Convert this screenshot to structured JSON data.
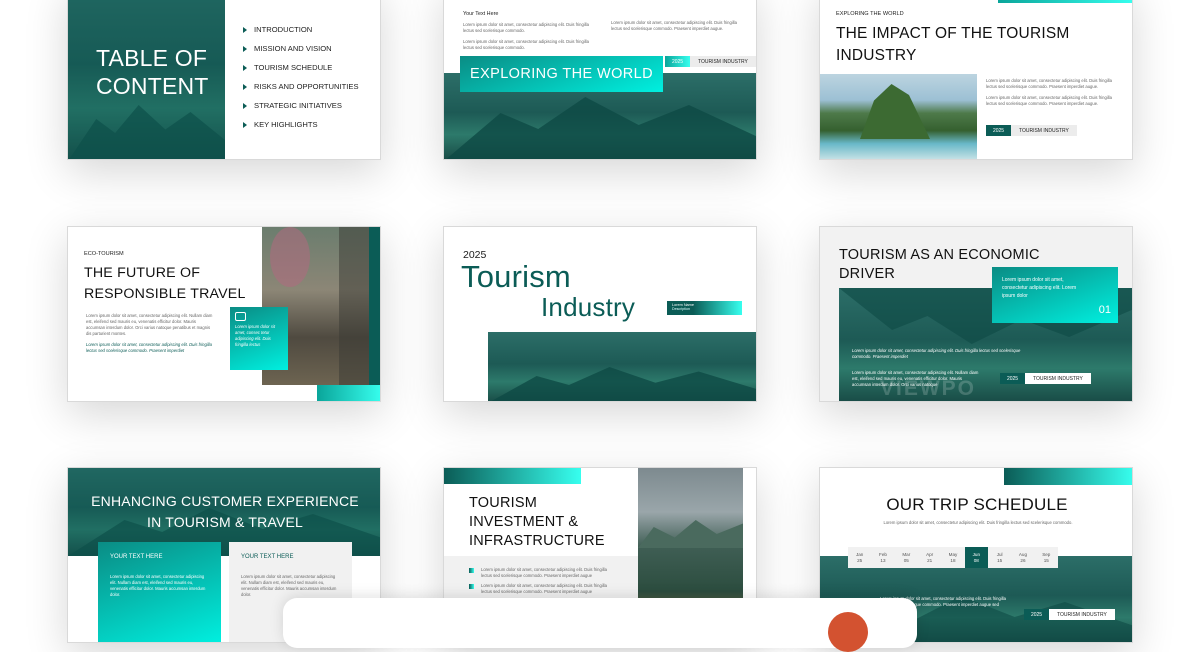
{
  "s1": {
    "title_l1": "TABLE OF",
    "title_l2": "CONTENT",
    "items": [
      "INTRODUCTION",
      "MISSION AND VISION",
      "TOURISM SCHEDULE",
      "RISKS AND OPPORTUNITIES",
      "STRATEGIC INITIATIVES",
      "KEY HIGHLIGHTS"
    ]
  },
  "s2": {
    "your_text": "Your Text Here",
    "lorem_a": "Lorem ipsum dolor sit amet, consectetur adipiscing elit. Duis fringilla lectus sed scelerisque commodo.",
    "lorem_b": "Lorem ipsum dolor sit amet, consectetur adipiscing elit. Duis fringilla lectus sed scelerisque commodo.",
    "lorem_c": "Lorem ipsum dolor sit amet, consectetur adipiscing elit. Duis fringilla lectus sed scelerisque commodo. Praesent imperdiet augue.",
    "banner": "EXPLORING THE WORLD",
    "year": "2025",
    "tag": "TOURISM INDUSTRY"
  },
  "s3": {
    "kicker": "EXPLORING THE WORLD",
    "title_l1": "THE IMPACT OF THE TOURISM",
    "title_l2": "INDUSTRY",
    "lorem_a": "Lorem ipsum dolor sit amet, consectetur adipiscing elit. Duis fringilla lectus sed scelerisque commodo. Praesent imperdiet augue.",
    "lorem_b": "Lorem ipsum dolor sit amet, consectetur adipiscing elit. Duis fringilla lectus sed scelerisque commodo. Praesent imperdiet augue.",
    "year": "2025",
    "tag": "TOURISM INDUSTRY"
  },
  "s4": {
    "kicker": "ECO-TOURISM",
    "title_l1": "THE FUTURE OF",
    "title_l2": "RESPONSIBLE TRAVEL",
    "lorem_a": "Lorem ipsum dolor sit amet, consectetur adipiscing elit. Nullam diam est, eleifend sed mauris eu, venenatis efficitur dolor. Mauris accumsan interdum dolor. Orci varius natoque penatibus et magnis dis parturient montes.",
    "lorem_b": "Lorem ipsum dolor sit amet, consectetur adipiscing elit. Duis fringilla lectus sed scelerisque commodo. Praesent imperdiet",
    "box_text": "Lorem ipsum dolor sit amet, consec tetur adipiscing elit. Duis fringilla lectus"
  },
  "s5": {
    "year": "2025",
    "title_l1": "Tourism",
    "title_l2": "Industry",
    "tag_l1": "Lorem Name",
    "tag_l2": "Description"
  },
  "s6": {
    "title_l1": "TOURISM AS AN ECONOMIC",
    "title_l2": "DRIVER",
    "box_text": "Lorem ipsum dolor sit amet, consectetur adipiscing elit. Lorem ipsum dolor",
    "box_num": "01",
    "lorem_a": "Lorem ipsum dolor sit amet, consectetur adipiscing elit. Duis fringilla lectus sed scelerisque commodo. Praesent imperdiet",
    "lorem_b": "Lorem ipsum dolor sit amet, consectetur adipiscing elit. Nullam diam est, eleifend sed mauris eu, venenatis efficitur dolor. Mauris accumsan interdum dolor. Orci varius natoque",
    "watermark": "VIEWPO",
    "year": "2025",
    "tag": "TOURISM INDUSTRY"
  },
  "s7": {
    "title_l1": "ENHANCING CUSTOMER EXPERIENCE",
    "title_l2": "IN TOURISM & TRAVEL",
    "card1_title": "YOUR TEXT HERE",
    "card1_text": "Lorem ipsum dolor sit amet, consectetur adipiscing elit. Nullam diam est, eleifend sed mauris eu, venenatis efficitur dolor. Mauris accumsan interdum dolor.",
    "card2_title": "YOUR TEXT HERE",
    "card2_text": "Lorem ipsum dolor sit amet, consectetur adipiscing elit. Nullam diam est, eleifend sed mauris eu, venenatis efficitur dolor. Mauris accumsan interdum dolor."
  },
  "s8": {
    "title_l1": "TOURISM",
    "title_l2": "INVESTMENT &",
    "title_l3": "INFRASTRUCTURE",
    "lorem_a": "Lorem ipsum dolor sit amet, consectetur adipiscing elit. Duis fringilla lectus sed scelerisque commodo. Praesent imperdiet augue",
    "lorem_b": "Lorem ipsum dolor sit amet, consectetur adipiscing elit. Duis fringilla lectus sed scelerisque commodo. Praesent imperdiet augue",
    "lorem_c": "Lorem ipsum dolor sit amet, consectetur adipiscing elit."
  },
  "s9": {
    "title": "OUR TRIP SCHEDULE",
    "lorem": "Lorem ipsum dolor sit amet, consectetur adipiscing elit. Duis fringilla lectus sed scelerisque commodo.",
    "months": [
      {
        "m": "Jan",
        "d": "25",
        "active": false
      },
      {
        "m": "Feb",
        "d": "13",
        "active": false
      },
      {
        "m": "Mar",
        "d": "05",
        "active": false
      },
      {
        "m": "Apr",
        "d": "21",
        "active": false
      },
      {
        "m": "May",
        "d": "18",
        "active": false
      },
      {
        "m": "Jun",
        "d": "08",
        "active": true
      },
      {
        "m": "Jul",
        "d": "15",
        "active": false
      },
      {
        "m": "Aug",
        "d": "26",
        "active": false
      },
      {
        "m": "Sep",
        "d": "15",
        "active": false
      }
    ],
    "lorem_b": "Lorem ipsum dolor sit amet, consectetur adipiscing elit. Duis fringilla lectus sed scelerisque commodo. Praesent imperdiet augue sed elementum.",
    "year": "2025",
    "tag": "TOURISM INDUSTRY"
  },
  "colors": {
    "teal": "#0b5c56",
    "cyan": "#00e8d8",
    "accent": "#0aa59a"
  }
}
